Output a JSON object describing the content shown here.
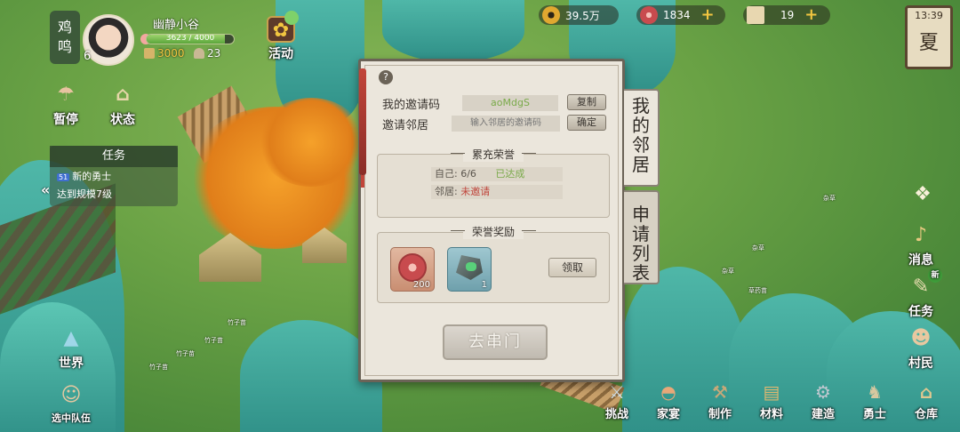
{
  "player": {
    "title_line1": "鸡",
    "title_line2": "鸣",
    "name": "幽静小谷",
    "level": "6",
    "exp_text": "3623 / 4000",
    "exp_fraction": 0.9,
    "coins_small": "3000",
    "population": "23"
  },
  "resources": {
    "copper": "39.5万",
    "jade": "1834",
    "tickets": "19",
    "plus": "+"
  },
  "clock": {
    "time": "13:39",
    "season": "夏"
  },
  "left_buttons": {
    "pause": "暂停",
    "status": "状态",
    "event": "活动",
    "world": "世界",
    "team": "选中队伍"
  },
  "tasks": {
    "header": "任务",
    "item_num": "51",
    "item_title": "新的勇士",
    "item_desc": "达到规模7级"
  },
  "right_buttons": {
    "messages": "消息",
    "quests": "任务",
    "quests_badge": "新",
    "villagers": "村民"
  },
  "bottom_bar": [
    "挑战",
    "家宴",
    "制作",
    "材料",
    "建造",
    "勇士",
    "仓库"
  ],
  "map_labels": [
    "竹子苗",
    "竹子苗",
    "竹子苗",
    "竹子苗",
    "杂草",
    "杂草",
    "杂草",
    "草药苗"
  ],
  "dialog": {
    "help": "?",
    "my_code_label": "我的邀请码",
    "my_code_value": "aoMdgS",
    "copy_label": "复制",
    "invite_label": "邀请邻居",
    "invite_placeholder": "输入邻居的邀请码",
    "confirm_label": "确定",
    "honor_title": "累充荣誉",
    "self_text": "自己: 6/6",
    "self_status": "已达成",
    "neighbor_label": "邻居:",
    "neighbor_status": "未邀请",
    "reward_title": "荣誉奖励",
    "reward_items": [
      {
        "icon": "jade-coin-icon",
        "qty": "200"
      },
      {
        "icon": "green-stone-icon",
        "qty": "1"
      }
    ],
    "claim_label": "领取",
    "visit_label": "去串门",
    "tab_neighbors": "我的邻居",
    "tab_applications": "申请列表"
  },
  "colors": {
    "status_ok": "#7aaa4a",
    "status_missing": "#c0463c",
    "panel_bg": "#ebe6dc",
    "accent_red": "#c2453a"
  }
}
